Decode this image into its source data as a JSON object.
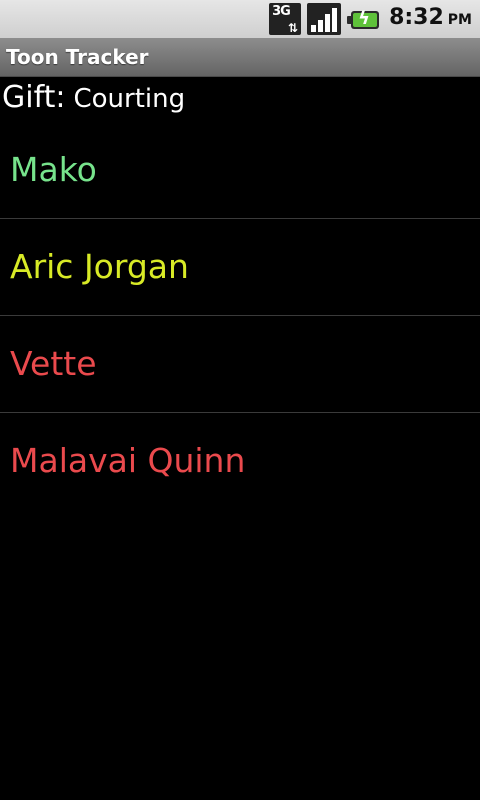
{
  "status_bar": {
    "network": "3G",
    "time": "8:32",
    "ampm": "PM",
    "battery_color": "#5fc23a"
  },
  "app": {
    "title": "Toon Tracker"
  },
  "gift": {
    "label": "Gift",
    "value": "Courting"
  },
  "toons": [
    {
      "name": "Mako",
      "color": "#77e38c"
    },
    {
      "name": "Aric Jorgan",
      "color": "#d8ea26"
    },
    {
      "name": "Vette",
      "color": "#ea4a4d"
    },
    {
      "name": "Malavai Quinn",
      "color": "#ea4a4d"
    }
  ]
}
